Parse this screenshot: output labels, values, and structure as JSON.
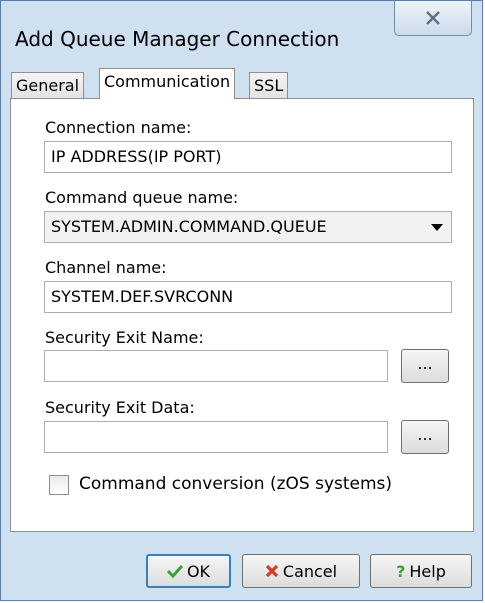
{
  "window": {
    "title": "Add Queue Manager Connection"
  },
  "tabs": [
    {
      "label": "General"
    },
    {
      "label": "Communication"
    },
    {
      "label": "SSL"
    }
  ],
  "active_tab": "Communication",
  "form": {
    "connection_name": {
      "label": "Connection name:",
      "value": "IP ADDRESS(IP PORT)"
    },
    "command_queue": {
      "label": "Command queue name:",
      "value": "SYSTEM.ADMIN.COMMAND.QUEUE"
    },
    "channel_name": {
      "label": "Channel name:",
      "value": "SYSTEM.DEF.SVRCONN"
    },
    "security_exit_name": {
      "label": "Security Exit Name:",
      "value": "",
      "browse_label": "..."
    },
    "security_exit_data": {
      "label": "Security Exit Data:",
      "value": "",
      "browse_label": "..."
    },
    "command_conversion": {
      "label": "Command conversion (zOS systems)",
      "checked": false
    }
  },
  "buttons": {
    "ok": {
      "label": "OK",
      "icon": "check-icon"
    },
    "cancel": {
      "label": "Cancel",
      "icon": "x-icon"
    },
    "help": {
      "label": "Help",
      "icon": "question-icon"
    }
  },
  "colors": {
    "frame": "#cfe0f1",
    "ok_icon": "#3aa13a",
    "cancel_icon": "#d33a2c",
    "help_icon": "#3aa13a"
  }
}
